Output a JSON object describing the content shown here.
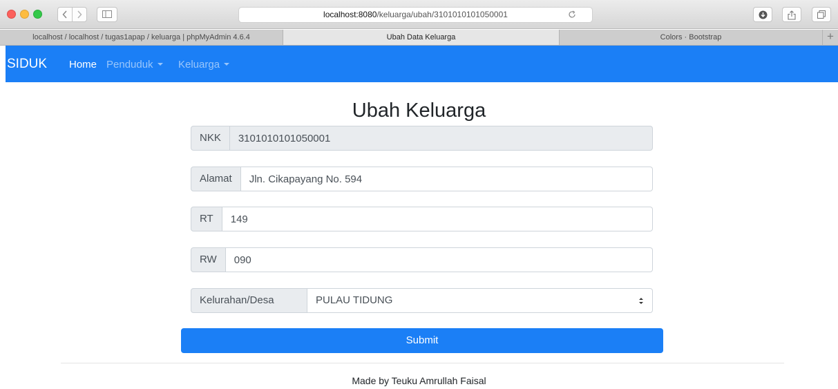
{
  "browser": {
    "url_host": "localhost:8080",
    "url_path": "/keluarga/ubah/3101010101050001",
    "tabs": [
      {
        "title": "localhost / localhost / tugas1apap / keluarga | phpMyAdmin 4.6.4",
        "active": false
      },
      {
        "title": "Ubah Data Keluarga",
        "active": true
      },
      {
        "title": "Colors · Bootstrap",
        "active": false
      }
    ],
    "new_tab_symbol": "+"
  },
  "navbar": {
    "brand": "SIDUK",
    "color": "#1b7ff6",
    "items": [
      {
        "label": "Home",
        "active": true,
        "dropdown": false
      },
      {
        "label": "Penduduk",
        "active": false,
        "dropdown": true
      },
      {
        "label": "Keluarga",
        "active": false,
        "dropdown": true
      }
    ]
  },
  "form": {
    "title": "Ubah Keluarga",
    "fields": {
      "nkk": {
        "label": "NKK",
        "value": "3101010101050001",
        "readonly": true
      },
      "alamat": {
        "label": "Alamat",
        "value": "Jln. Cikapayang No. 594"
      },
      "rt": {
        "label": "RT",
        "value": "149"
      },
      "rw": {
        "label": "RW",
        "value": "090"
      },
      "kelurahan": {
        "label": "Kelurahan/Desa",
        "selected": "PULAU TIDUNG"
      }
    },
    "submit_label": "Submit"
  },
  "footer": {
    "text": "Made by Teuku Amrullah Faisal"
  },
  "icons": [
    "back-icon",
    "forward-icon",
    "sidebar-icon",
    "reload-icon",
    "download-icon",
    "share-icon",
    "tabs-overview-icon",
    "caret-down-icon",
    "select-arrows-icon"
  ]
}
